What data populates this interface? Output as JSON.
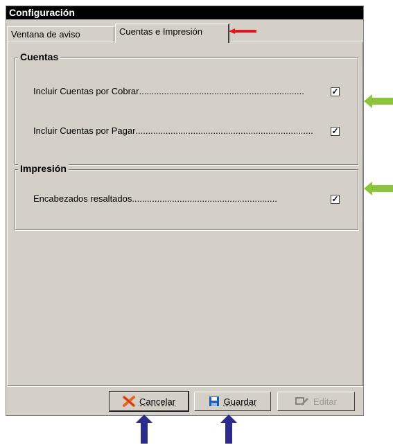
{
  "window": {
    "title": "Configuración"
  },
  "tabs": [
    {
      "label": "Ventana de aviso"
    },
    {
      "label": "Cuentas e Impresión"
    }
  ],
  "groups": {
    "cuentas": {
      "title": "Cuentas",
      "options": [
        {
          "label": "Incluir Cuentas por Cobrar",
          "checked": true
        },
        {
          "label": "Incluir Cuentas por Pagar",
          "checked": true
        }
      ]
    },
    "impresion": {
      "title": "Impresión",
      "options": [
        {
          "label": "Encabezados resaltados",
          "checked": true
        }
      ]
    }
  },
  "buttons": {
    "cancel": {
      "label": "Cancelar",
      "icon": "x-icon"
    },
    "save": {
      "label": "Guardar",
      "icon": "floppy-disk-icon"
    },
    "edit": {
      "label": "Editar",
      "icon": "pencil-icon",
      "disabled": true
    }
  },
  "colors": {
    "window_bg": "#d4d0c8",
    "title_bg": "#000000",
    "annotation_red": "#e8141c",
    "annotation_green": "#8cc43c",
    "annotation_blue": "#2c2c8c"
  },
  "check_glyph": "✓"
}
